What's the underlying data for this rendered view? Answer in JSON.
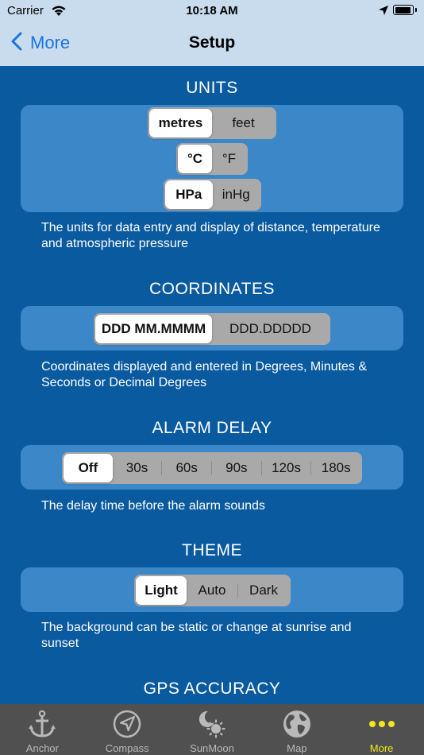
{
  "status_bar": {
    "carrier": "Carrier",
    "time": "10:18 AM"
  },
  "nav": {
    "back_label": "More",
    "title": "Setup"
  },
  "sections": {
    "units": {
      "title": "UNITS",
      "distance": {
        "options": [
          "metres",
          "feet"
        ],
        "selected": "metres"
      },
      "temperature": {
        "options": [
          "°C",
          "°F"
        ],
        "selected": "°C"
      },
      "pressure": {
        "options": [
          "HPa",
          "inHg"
        ],
        "selected": "HPa"
      },
      "description": "The units for data entry and display of distance, temperature and atmospheric pressure"
    },
    "coordinates": {
      "title": "COORDINATES",
      "format": {
        "options": [
          "DDD MM.MMMM",
          "DDD.DDDDD"
        ],
        "selected": "DDD MM.MMMM"
      },
      "description": "Coordinates displayed and entered in Degrees, Minutes & Seconds or Decimal Degrees"
    },
    "alarm_delay": {
      "title": "ALARM DELAY",
      "delay": {
        "options": [
          "Off",
          "30s",
          "60s",
          "90s",
          "120s",
          "180s"
        ],
        "selected": "Off"
      },
      "description": "The delay time before the alarm sounds"
    },
    "theme": {
      "title": "THEME",
      "mode": {
        "options": [
          "Light",
          "Auto",
          "Dark"
        ],
        "selected": "Light"
      },
      "description": "The background can be static or change at sunrise and sunset"
    },
    "gps_accuracy": {
      "title": "GPS ACCURACY"
    }
  },
  "tabs": [
    {
      "label": "Anchor",
      "icon": "anchor-icon"
    },
    {
      "label": "Compass",
      "icon": "compass-icon"
    },
    {
      "label": "SunMoon",
      "icon": "sun-moon-icon"
    },
    {
      "label": "Map",
      "icon": "globe-icon"
    },
    {
      "label": "More",
      "icon": "more-dots-icon",
      "active": true
    }
  ],
  "colors": {
    "background": "#0a5aa0",
    "card": "#3c87c8",
    "nav_bar": "#c9dced",
    "tint": "#1a73e0",
    "tab_bar": "#505050",
    "tab_active": "#f4e61d"
  }
}
